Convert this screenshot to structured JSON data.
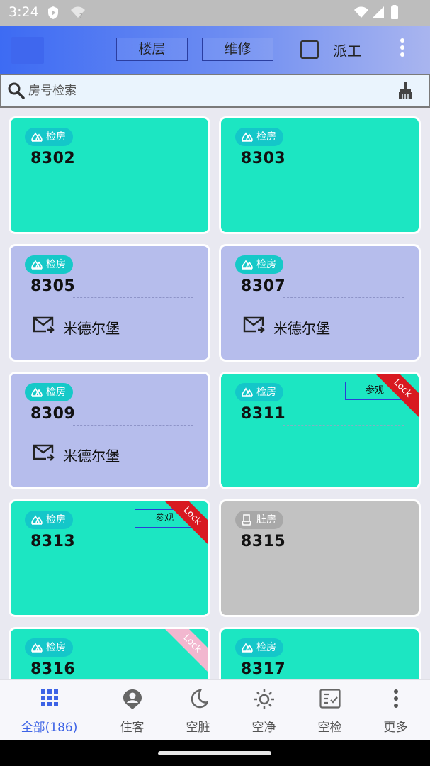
{
  "status_bar": {
    "time": "3:24"
  },
  "app_bar": {
    "tabs": [
      {
        "label": "楼层"
      },
      {
        "label": "维修"
      }
    ],
    "dispatch_label": "派工",
    "dispatch_checked": false
  },
  "search": {
    "placeholder": "房号检索",
    "value": ""
  },
  "rooms": [
    {
      "number": "8302",
      "status_label": "检房",
      "status": "clean",
      "guest": "",
      "visit": "",
      "lock": ""
    },
    {
      "number": "8303",
      "status_label": "检房",
      "status": "clean",
      "guest": "",
      "visit": "",
      "lock": ""
    },
    {
      "number": "8305",
      "status_label": "检房",
      "status": "occupied",
      "guest": "米德尔堡",
      "visit": "",
      "lock": ""
    },
    {
      "number": "8307",
      "status_label": "检房",
      "status": "occupied",
      "guest": "米德尔堡",
      "visit": "",
      "lock": ""
    },
    {
      "number": "8309",
      "status_label": "检房",
      "status": "occupied",
      "guest": "米德尔堡",
      "visit": "",
      "lock": ""
    },
    {
      "number": "8311",
      "status_label": "检房",
      "status": "clean",
      "guest": "",
      "visit": "参观",
      "lock": "Lock"
    },
    {
      "number": "8313",
      "status_label": "检房",
      "status": "clean",
      "guest": "",
      "visit": "参观",
      "lock": "Lock"
    },
    {
      "number": "8315",
      "status_label": "脏房",
      "status": "dirty",
      "guest": "",
      "visit": "",
      "lock": ""
    },
    {
      "number": "8316",
      "status_label": "检房",
      "status": "clean",
      "guest": "",
      "visit": "",
      "lock": "Lock"
    },
    {
      "number": "8317",
      "status_label": "检房",
      "status": "clean",
      "guest": "",
      "visit": "",
      "lock": ""
    }
  ],
  "bottom_nav": [
    {
      "label": "全部(186)",
      "icon": "grid-icon",
      "active": true
    },
    {
      "label": "住客",
      "icon": "guest-pin-icon",
      "active": false
    },
    {
      "label": "空脏",
      "icon": "moon-icon",
      "active": false
    },
    {
      "label": "空净",
      "icon": "sun-icon",
      "active": false
    },
    {
      "label": "空检",
      "icon": "checklist-icon",
      "active": false
    },
    {
      "label": "更多",
      "icon": "more-vertical-icon",
      "active": false
    }
  ],
  "colors": {
    "accent": "#3d63e6",
    "clean": "#1ce6c2",
    "occupied": "#b6bdec",
    "dirty": "#c2c2c2",
    "lock_active": "#d81921",
    "lock_faded": "#f2b7cf"
  }
}
